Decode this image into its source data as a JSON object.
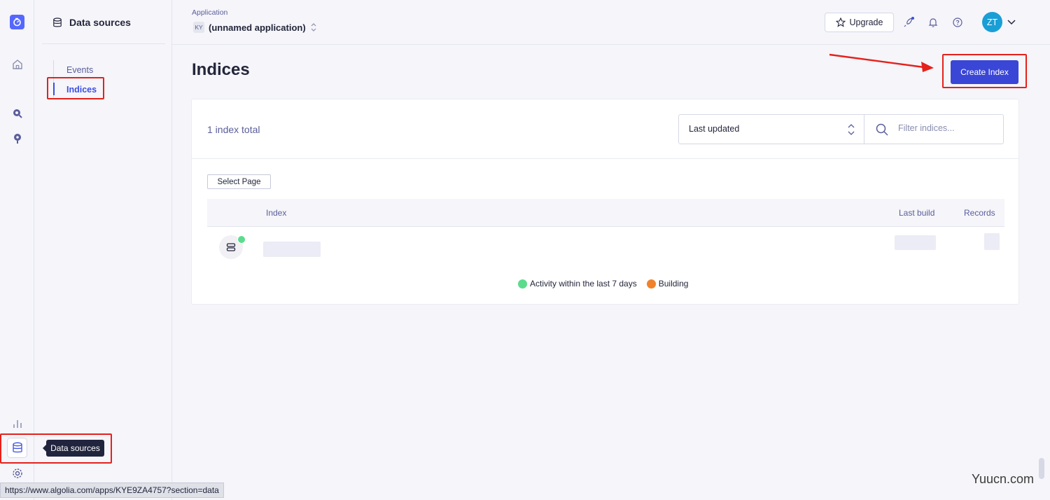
{
  "sidebar": {
    "title": "Data sources",
    "items": [
      {
        "label": "Events"
      },
      {
        "label": "Indices"
      }
    ]
  },
  "header": {
    "app_label": "Application",
    "app_badge": "KY",
    "app_name": "(unnamed application)",
    "upgrade_label": "Upgrade",
    "avatar_initials": "ZT"
  },
  "main": {
    "title": "Indices",
    "create_button": "Create Index",
    "total_text": "1 index total",
    "sort_value": "Last updated",
    "filter_placeholder": "Filter indices...",
    "select_page_label": "Select Page",
    "columns": {
      "index": "Index",
      "last_build": "Last build",
      "records": "Records"
    },
    "legend": [
      {
        "label": "Activity within the last 7 days",
        "color": "#5adc8c"
      },
      {
        "label": "Building",
        "color": "#f0822b"
      }
    ]
  },
  "tooltip": "Data sources",
  "status_url": "https://www.algolia.com/apps/KYE9ZA4757?section=data",
  "watermark": "Yuucn.com",
  "colors": {
    "accent": "#3a46d6",
    "highlight": "#e5211c",
    "avatar": "#1a9ed6"
  }
}
